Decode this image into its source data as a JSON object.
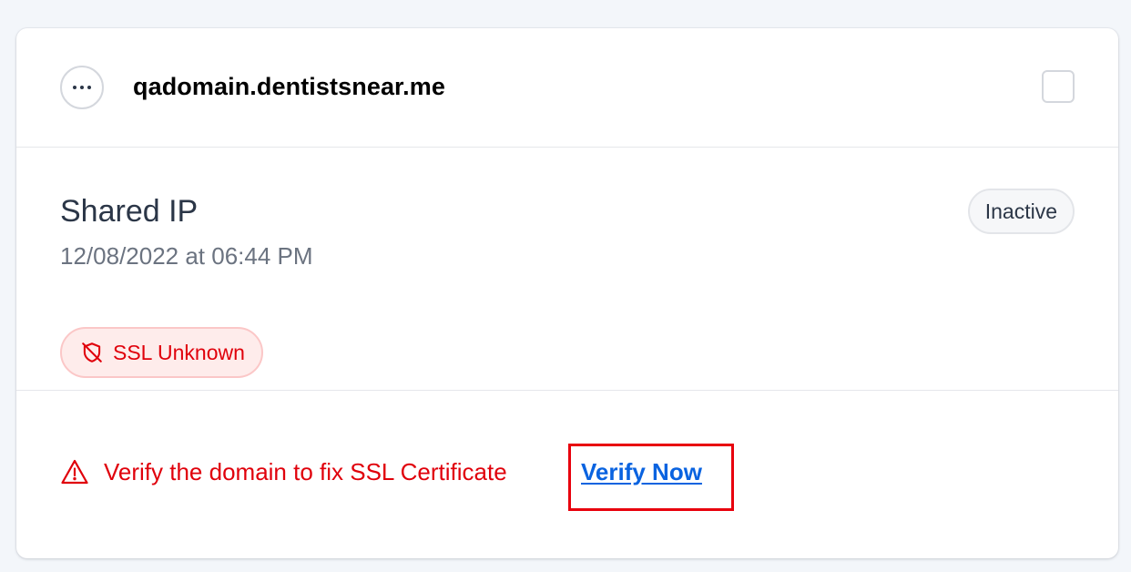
{
  "card": {
    "domain": "qadomain.dentistsnear.me",
    "menu_icon": "ellipsis-icon",
    "checkbox_checked": false
  },
  "details": {
    "ip_type": "Shared IP",
    "created_at": "12/08/2022 at 06:44 PM",
    "status": "Inactive",
    "ssl_icon": "shield-off-icon",
    "ssl_label": "SSL Unknown"
  },
  "footer": {
    "warning_icon": "warning-triangle-icon",
    "warning_text": "Verify the domain to fix SSL Certificate",
    "action_label": "Verify Now"
  },
  "colors": {
    "danger": "#e0000b",
    "link": "#0a63e0",
    "danger_bg": "#feeceb",
    "muted_text": "#6b7380",
    "heading_text": "#2b3647"
  }
}
